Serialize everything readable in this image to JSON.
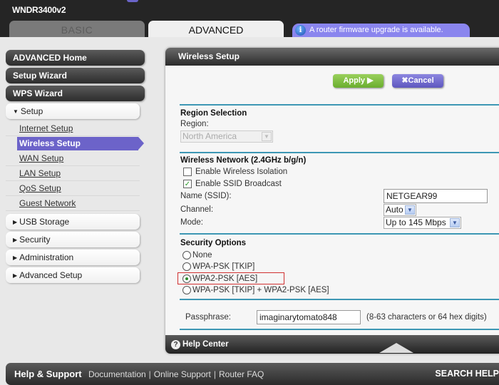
{
  "header": {
    "model": "WNDR3400v2",
    "tabs": [
      {
        "label": "BASIC",
        "active": false
      },
      {
        "label": "ADVANCED",
        "active": true
      }
    ],
    "notice": {
      "icon": "info-icon",
      "text": "A router firmware upgrade is available."
    }
  },
  "sidebar": {
    "top_items": [
      {
        "label": "ADVANCED Home"
      },
      {
        "label": "Setup Wizard"
      },
      {
        "label": "WPS Wizard"
      }
    ],
    "setup": {
      "label": "Setup",
      "expanded": true,
      "items": [
        {
          "label": "Internet Setup",
          "active": false
        },
        {
          "label": "Wireless Setup",
          "active": true
        },
        {
          "label": "WAN Setup",
          "active": false
        },
        {
          "label": "LAN Setup",
          "active": false
        },
        {
          "label": "QoS Setup",
          "active": false
        },
        {
          "label": "Guest Network",
          "active": false
        }
      ]
    },
    "collapsed_sections": [
      {
        "label": "USB Storage"
      },
      {
        "label": "Security"
      },
      {
        "label": "Administration"
      },
      {
        "label": "Advanced Setup"
      }
    ]
  },
  "panel": {
    "title": "Wireless Setup",
    "apply_label": "Apply ▶",
    "cancel_label": "✖Cancel",
    "region": {
      "heading": "Region Selection",
      "label": "Region:",
      "value": "North America",
      "disabled": true
    },
    "wireless_network": {
      "heading": "Wireless Network (2.4GHz b/g/n)",
      "isolation_label": "Enable Wireless Isolation",
      "isolation_checked": false,
      "ssid_broadcast_label": "Enable SSID Broadcast",
      "ssid_broadcast_checked": true,
      "ssid_label": "Name (SSID):",
      "ssid_value": "NETGEAR99",
      "channel_label": "Channel:",
      "channel_value": "Auto",
      "mode_label": "Mode:",
      "mode_value": "Up to 145 Mbps"
    },
    "security": {
      "heading": "Security Options",
      "options": [
        {
          "label": "None",
          "selected": false
        },
        {
          "label": "WPA-PSK [TKIP]",
          "selected": false
        },
        {
          "label": "WPA2-PSK [AES]",
          "selected": true
        },
        {
          "label": "WPA-PSK [TKIP] + WPA2-PSK [AES]",
          "selected": false
        }
      ]
    },
    "passphrase": {
      "label": "Passphrase:",
      "value": "imaginarytomato848",
      "hint": "(8-63 characters or 64 hex digits)"
    },
    "help_center": "Help Center"
  },
  "footer": {
    "title": "Help & Support",
    "links": [
      "Documentation",
      "Online Support",
      "Router FAQ"
    ],
    "search": "SEARCH HELP"
  },
  "colors": {
    "accent_purple": "#6c63c9",
    "apply_green": "#7cbf3e",
    "divider_blue": "#3d97b4",
    "highlight_red": "#d03030"
  }
}
